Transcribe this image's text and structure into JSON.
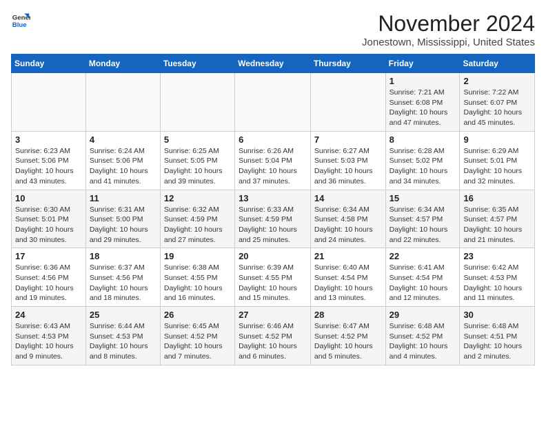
{
  "logo": {
    "line1": "General",
    "line2": "Blue"
  },
  "title": "November 2024",
  "location": "Jonestown, Mississippi, United States",
  "weekdays": [
    "Sunday",
    "Monday",
    "Tuesday",
    "Wednesday",
    "Thursday",
    "Friday",
    "Saturday"
  ],
  "weeks": [
    [
      {
        "day": "",
        "info": ""
      },
      {
        "day": "",
        "info": ""
      },
      {
        "day": "",
        "info": ""
      },
      {
        "day": "",
        "info": ""
      },
      {
        "day": "",
        "info": ""
      },
      {
        "day": "1",
        "info": "Sunrise: 7:21 AM\nSunset: 6:08 PM\nDaylight: 10 hours\nand 47 minutes."
      },
      {
        "day": "2",
        "info": "Sunrise: 7:22 AM\nSunset: 6:07 PM\nDaylight: 10 hours\nand 45 minutes."
      }
    ],
    [
      {
        "day": "3",
        "info": "Sunrise: 6:23 AM\nSunset: 5:06 PM\nDaylight: 10 hours\nand 43 minutes."
      },
      {
        "day": "4",
        "info": "Sunrise: 6:24 AM\nSunset: 5:06 PM\nDaylight: 10 hours\nand 41 minutes."
      },
      {
        "day": "5",
        "info": "Sunrise: 6:25 AM\nSunset: 5:05 PM\nDaylight: 10 hours\nand 39 minutes."
      },
      {
        "day": "6",
        "info": "Sunrise: 6:26 AM\nSunset: 5:04 PM\nDaylight: 10 hours\nand 37 minutes."
      },
      {
        "day": "7",
        "info": "Sunrise: 6:27 AM\nSunset: 5:03 PM\nDaylight: 10 hours\nand 36 minutes."
      },
      {
        "day": "8",
        "info": "Sunrise: 6:28 AM\nSunset: 5:02 PM\nDaylight: 10 hours\nand 34 minutes."
      },
      {
        "day": "9",
        "info": "Sunrise: 6:29 AM\nSunset: 5:01 PM\nDaylight: 10 hours\nand 32 minutes."
      }
    ],
    [
      {
        "day": "10",
        "info": "Sunrise: 6:30 AM\nSunset: 5:01 PM\nDaylight: 10 hours\nand 30 minutes."
      },
      {
        "day": "11",
        "info": "Sunrise: 6:31 AM\nSunset: 5:00 PM\nDaylight: 10 hours\nand 29 minutes."
      },
      {
        "day": "12",
        "info": "Sunrise: 6:32 AM\nSunset: 4:59 PM\nDaylight: 10 hours\nand 27 minutes."
      },
      {
        "day": "13",
        "info": "Sunrise: 6:33 AM\nSunset: 4:59 PM\nDaylight: 10 hours\nand 25 minutes."
      },
      {
        "day": "14",
        "info": "Sunrise: 6:34 AM\nSunset: 4:58 PM\nDaylight: 10 hours\nand 24 minutes."
      },
      {
        "day": "15",
        "info": "Sunrise: 6:34 AM\nSunset: 4:57 PM\nDaylight: 10 hours\nand 22 minutes."
      },
      {
        "day": "16",
        "info": "Sunrise: 6:35 AM\nSunset: 4:57 PM\nDaylight: 10 hours\nand 21 minutes."
      }
    ],
    [
      {
        "day": "17",
        "info": "Sunrise: 6:36 AM\nSunset: 4:56 PM\nDaylight: 10 hours\nand 19 minutes."
      },
      {
        "day": "18",
        "info": "Sunrise: 6:37 AM\nSunset: 4:56 PM\nDaylight: 10 hours\nand 18 minutes."
      },
      {
        "day": "19",
        "info": "Sunrise: 6:38 AM\nSunset: 4:55 PM\nDaylight: 10 hours\nand 16 minutes."
      },
      {
        "day": "20",
        "info": "Sunrise: 6:39 AM\nSunset: 4:55 PM\nDaylight: 10 hours\nand 15 minutes."
      },
      {
        "day": "21",
        "info": "Sunrise: 6:40 AM\nSunset: 4:54 PM\nDaylight: 10 hours\nand 13 minutes."
      },
      {
        "day": "22",
        "info": "Sunrise: 6:41 AM\nSunset: 4:54 PM\nDaylight: 10 hours\nand 12 minutes."
      },
      {
        "day": "23",
        "info": "Sunrise: 6:42 AM\nSunset: 4:53 PM\nDaylight: 10 hours\nand 11 minutes."
      }
    ],
    [
      {
        "day": "24",
        "info": "Sunrise: 6:43 AM\nSunset: 4:53 PM\nDaylight: 10 hours\nand 9 minutes."
      },
      {
        "day": "25",
        "info": "Sunrise: 6:44 AM\nSunset: 4:53 PM\nDaylight: 10 hours\nand 8 minutes."
      },
      {
        "day": "26",
        "info": "Sunrise: 6:45 AM\nSunset: 4:52 PM\nDaylight: 10 hours\nand 7 minutes."
      },
      {
        "day": "27",
        "info": "Sunrise: 6:46 AM\nSunset: 4:52 PM\nDaylight: 10 hours\nand 6 minutes."
      },
      {
        "day": "28",
        "info": "Sunrise: 6:47 AM\nSunset: 4:52 PM\nDaylight: 10 hours\nand 5 minutes."
      },
      {
        "day": "29",
        "info": "Sunrise: 6:48 AM\nSunset: 4:52 PM\nDaylight: 10 hours\nand 4 minutes."
      },
      {
        "day": "30",
        "info": "Sunrise: 6:48 AM\nSunset: 4:51 PM\nDaylight: 10 hours\nand 2 minutes."
      }
    ]
  ]
}
